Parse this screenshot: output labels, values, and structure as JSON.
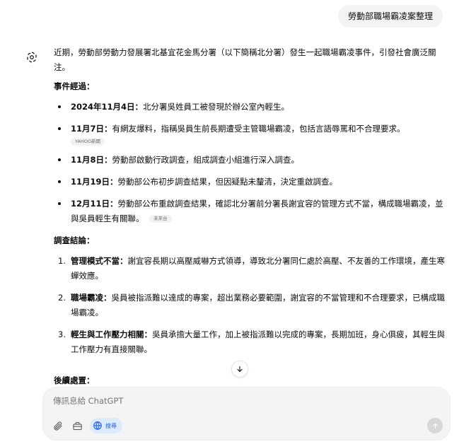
{
  "user_message": "勞動部職場霸凌案整理",
  "assistant": {
    "intro": "近期，勞動部勞動力發展署北基宜花金馬分署（以下簡稱北分署）發生一起職場霸凌事件，引發社會廣泛關注。",
    "events_title": "事件經過：",
    "events": [
      {
        "date": "2024年11月4日：",
        "text": "北分署吳姓員工被發現於辦公室內輕生。",
        "source": ""
      },
      {
        "date": "11月7日：",
        "text": "有網友爆料，指稱吳員生前長期遭受主管職場霸凌，包括言語辱罵和不合理要求。",
        "source": "YAHOO新聞"
      },
      {
        "date": "11月8日：",
        "text": "勞動部啟動行政調查，組成調查小組進行深入調查。",
        "source": ""
      },
      {
        "date": "11月19日：",
        "text": "勞動部公布初步調查結果，但因疑點未釐清，決定重啟調查。",
        "source": ""
      },
      {
        "date": "12月11日：",
        "text": "勞動部公布重啟調查結果，確認北分署前分署長謝宜容的管理方式不當，構成職場霸凌，並與吳員輕生有關聯。",
        "source": "未來台"
      }
    ],
    "conclusions_title": "調查結論：",
    "conclusions": [
      {
        "num": "1.",
        "label": "管理模式不當：",
        "text": "謝宜容長期以高壓威嚇方式領導，導致北分署同仁處於高壓、不友善的工作環境，產生寒蟬效應。"
      },
      {
        "num": "2.",
        "label": "職場霸凌：",
        "text": "吳員被指派難以達成的專案，超出業務必要範圍，謝宜容的不當管理和不合理要求，已構成職場霸凌。"
      },
      {
        "num": "3.",
        "label": "輕生與工作壓力相關：",
        "text": "吳員承擔大量工作，加上被指派難以完成的專案，長期加班，身心俱疲，其輕生與工作壓力有直接關聯。"
      }
    ],
    "followup_title": "後續處置："
  },
  "composer": {
    "placeholder": "傳訊息給 ChatGPT",
    "search_label": "搜尋"
  },
  "icons": {
    "avatar": "openai-logo-icon",
    "scroll": "arrow-down-icon",
    "attach": "paperclip-icon",
    "tools": "toolbox-icon",
    "search": "globe-icon",
    "send": "arrow-up-icon"
  },
  "colors": {
    "search_pill_bg": "#dbeafe",
    "search_pill_text": "#2563eb",
    "send_disabled": "#d7d7d7"
  }
}
